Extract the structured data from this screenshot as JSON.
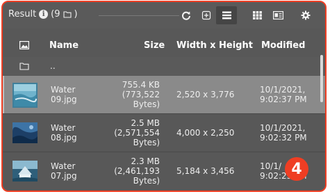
{
  "panel": {
    "title": "Result",
    "count": "(9",
    "count_close": ")"
  },
  "toolbar": {
    "refresh_icon": "refresh-icon",
    "add_icon": "add-icon",
    "list_icon": "list-view-icon",
    "grid_icon": "grid-view-icon",
    "details_icon": "details-view-icon",
    "settings_icon": "gear-icon",
    "active_view": "list"
  },
  "columns": {
    "name": "Name",
    "size": "Size",
    "dimensions": "Width x Height",
    "modified": "Modified"
  },
  "parent_dir": {
    "label": ".."
  },
  "files": [
    {
      "name_line1": "Water",
      "name_line2": "09.jpg",
      "size_line1": "755.4 KB",
      "size_line2": "(773,522",
      "size_line3": "Bytes)",
      "dimensions": "2,520 x 3,776",
      "modified_line1": "10/1/2021,",
      "modified_line2": "9:02:37 PM",
      "selected": true
    },
    {
      "name_line1": "Water",
      "name_line2": "08.jpg",
      "size_line1": "2.5 MB",
      "size_line2": "(2,571,554",
      "size_line3": "Bytes)",
      "dimensions": "4,000 x 2,250",
      "modified_line1": "10/1/2021,",
      "modified_line2": "9:02:32 PM",
      "selected": false
    },
    {
      "name_line1": "Water",
      "name_line2": "07.jpg",
      "size_line1": "2.3 MB",
      "size_line2": "(2,461,193",
      "size_line3": "Bytes)",
      "dimensions": "5,184 x 3,456",
      "modified_line1": "10/1/",
      "modified_line2": "9:02:25 PM",
      "selected": false
    }
  ],
  "step_badge": "4",
  "colors": {
    "accent": "#ef3e23",
    "panel_bg": "#585858",
    "selected_row": "#8a8a8a"
  }
}
